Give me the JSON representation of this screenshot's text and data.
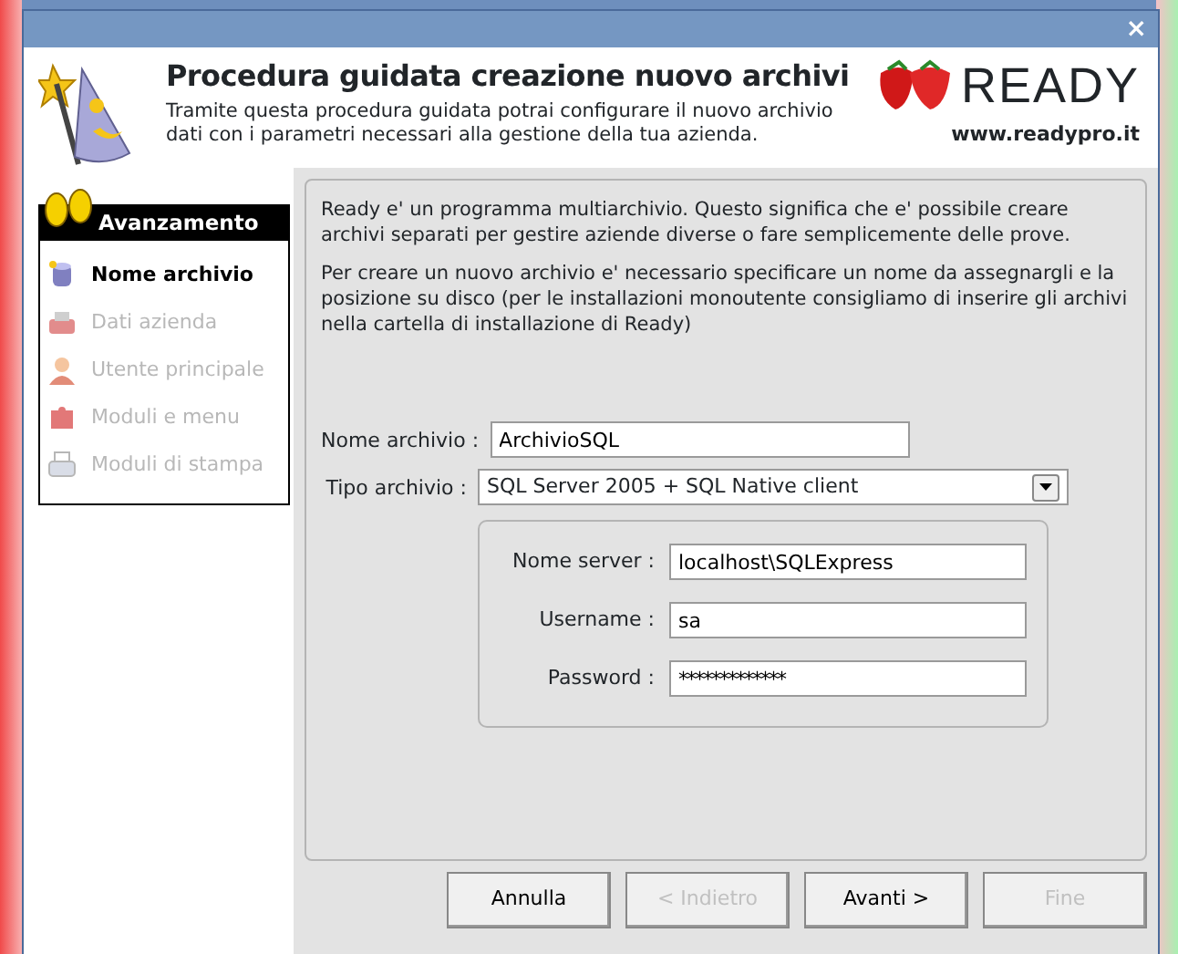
{
  "window": {
    "close": "×"
  },
  "header": {
    "title": "Procedura guidata creazione nuovo archivi",
    "subtitle": "Tramite questa procedura guidata potrai configurare il nuovo archivio dati con i parametri necessari alla gestione della tua azienda.",
    "brand": "READY",
    "url": "www.readypro.it"
  },
  "progress": {
    "title": "Avanzamento",
    "steps": [
      {
        "label": "Nome archivio",
        "kind": "database",
        "selected": true,
        "disabled": false
      },
      {
        "label": "Dati azienda",
        "kind": "fax",
        "selected": false,
        "disabled": true
      },
      {
        "label": "Utente principale",
        "kind": "user",
        "selected": false,
        "disabled": true
      },
      {
        "label": "Moduli e menu",
        "kind": "puzzle",
        "selected": false,
        "disabled": true
      },
      {
        "label": "Moduli di stampa",
        "kind": "printer",
        "selected": false,
        "disabled": true
      }
    ]
  },
  "intro": [
    "Ready e' un programma multiarchivio. Questo significa che e' possibile creare archivi separati per gestire aziende diverse o fare semplicemente delle prove.",
    "Per creare un nuovo archivio e' necessario specificare un nome da assegnargli e la posizione su disco (per le installazioni monoutente consigliamo di inserire gli archivi nella cartella di installazione di Ready)"
  ],
  "form": {
    "name": {
      "label": "Nome archivio :",
      "value": "ArchivioSQL"
    },
    "type": {
      "label": "Tipo archivio :",
      "value": "SQL Server 2005 + SQL Native client"
    },
    "server": [
      {
        "label": "Nome server :",
        "value": "localhost\\SQLExpress",
        "kind": "text"
      },
      {
        "label": "Username :",
        "value": "sa",
        "kind": "text"
      },
      {
        "label": "Password :",
        "value": "*************",
        "kind": "password"
      }
    ]
  },
  "buttons": [
    {
      "label": "Annulla",
      "disabled": false
    },
    {
      "label": "< Indietro",
      "disabled": true
    },
    {
      "label": "Avanti >",
      "disabled": false
    },
    {
      "label": "Fine",
      "disabled": true
    }
  ]
}
